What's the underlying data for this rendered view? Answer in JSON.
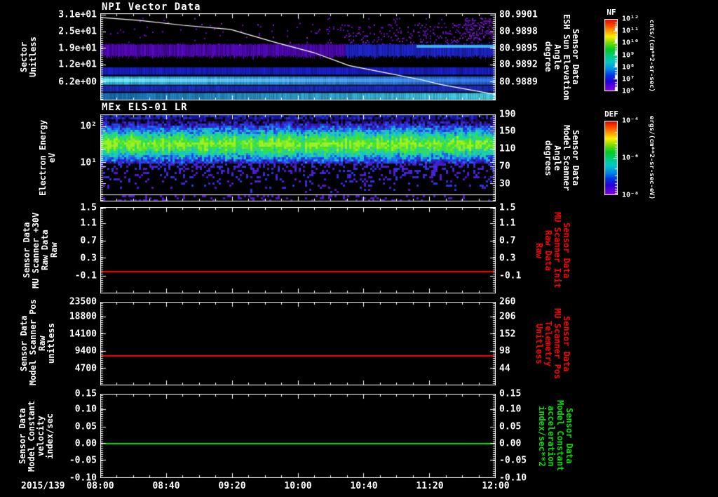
{
  "app": {
    "bg": "#000000",
    "fg": "#ffffff",
    "red": "#ff0000",
    "green": "#00e000"
  },
  "panels": {
    "p1": {
      "title": "NPI Vector Data",
      "left_title_lines": [
        "Sector",
        "Unitless"
      ],
      "left_ticks": [
        {
          "t": "3.1e+01",
          "f": 0.02
        },
        {
          "t": "2.5e+01",
          "f": 0.21
        },
        {
          "t": "1.9e+01",
          "f": 0.4
        },
        {
          "t": "1.2e+01",
          "f": 0.59
        },
        {
          "t": "6.2e+00",
          "f": 0.79
        }
      ],
      "right_ticks": [
        {
          "t": "80.9901",
          "f": 0.02
        },
        {
          "t": "80.9898",
          "f": 0.21
        },
        {
          "t": "80.9895",
          "f": 0.4
        },
        {
          "t": "80.9892",
          "f": 0.59
        },
        {
          "t": "80.9889",
          "f": 0.79
        }
      ],
      "right_title_lines": [
        "Sensor Data",
        "ESH Sun Elevation",
        "Angle",
        "degree"
      ]
    },
    "p2": {
      "title": "MEx ELS-01 LR",
      "left_title_lines": [
        "Electron Energy",
        "eV"
      ],
      "left_ticks": [
        {
          "t": "10²",
          "f": 0.137
        },
        {
          "t": "10¹",
          "f": 0.556
        }
      ],
      "right_ticks": [
        {
          "t": "190",
          "f": 0.0
        },
        {
          "t": "150",
          "f": 0.19
        },
        {
          "t": "110",
          "f": 0.395
        },
        {
          "t": "70",
          "f": 0.6
        },
        {
          "t": "30",
          "f": 0.8
        }
      ],
      "right_title_lines": [
        "Sensor Data",
        "Model Scanner",
        "Angle",
        "degrees"
      ]
    },
    "p3": {
      "left_title_lines": [
        "Sensor Data",
        "MU Scanner +30V",
        "Raw Data",
        "Raw"
      ],
      "left_ticks": [
        {
          "t": "1.5",
          "f": 0.01
        },
        {
          "t": "1.1",
          "f": 0.19
        },
        {
          "t": "0.7",
          "f": 0.39
        },
        {
          "t": "0.3",
          "f": 0.59
        },
        {
          "t": "-0.1",
          "f": 0.8
        }
      ],
      "right_ticks": [
        {
          "t": "1.5",
          "f": 0.01
        },
        {
          "t": "1.1",
          "f": 0.19
        },
        {
          "t": "0.7",
          "f": 0.39
        },
        {
          "t": "0.3",
          "f": 0.59
        },
        {
          "t": "-0.1",
          "f": 0.8
        }
      ],
      "right_title_lines": [
        "Sensor Data",
        "MU Scanner Init",
        "Raw Data",
        "Raw"
      ]
    },
    "p4": {
      "left_title_lines": [
        "Sensor Data",
        "Model Scanner Pos",
        "Raw",
        "unitless"
      ],
      "left_ticks": [
        {
          "t": "23500",
          "f": 0.0
        },
        {
          "t": "18800",
          "f": 0.18
        },
        {
          "t": "14100",
          "f": 0.385
        },
        {
          "t": "9400",
          "f": 0.59
        },
        {
          "t": "4700",
          "f": 0.8
        }
      ],
      "right_ticks": [
        {
          "t": "260",
          "f": 0.0
        },
        {
          "t": "206",
          "f": 0.18
        },
        {
          "t": "152",
          "f": 0.385
        },
        {
          "t": "98",
          "f": 0.59
        },
        {
          "t": "44",
          "f": 0.8
        }
      ],
      "right_title_lines": [
        "Sensor Data",
        "MU Scanner Pos",
        "Telemetry",
        "Unitless"
      ]
    },
    "p5": {
      "left_title_lines": [
        "Sensor Data",
        "Model Constant",
        "velocity",
        "index/sec"
      ],
      "left_ticks": [
        {
          "t": "0.15",
          "f": 0.0
        },
        {
          "t": "0.10",
          "f": 0.183
        },
        {
          "t": "0.05",
          "f": 0.392
        },
        {
          "t": "0.00",
          "f": 0.592
        },
        {
          "t": "-0.05",
          "f": 0.792
        },
        {
          "t": "-0.10",
          "f": 1.0
        }
      ],
      "right_ticks": [
        {
          "t": "0.15",
          "f": 0.0
        },
        {
          "t": "0.10",
          "f": 0.183
        },
        {
          "t": "0.05",
          "f": 0.392
        },
        {
          "t": "0.00",
          "f": 0.592
        },
        {
          "t": "-0.05",
          "f": 0.792
        },
        {
          "t": "-0.10",
          "f": 1.0
        }
      ],
      "right_title_lines": [
        "Sensor Data",
        "Model Constant",
        "acceleration",
        "index/sec**2"
      ]
    }
  },
  "xaxis": {
    "date": "2015/139",
    "ticks": [
      {
        "t": "08:00",
        "x": 0.0
      },
      {
        "t": "08:40",
        "x": 0.1667
      },
      {
        "t": "09:20",
        "x": 0.3333
      },
      {
        "t": "10:00",
        "x": 0.5
      },
      {
        "t": "10:40",
        "x": 0.6667
      },
      {
        "t": "11:20",
        "x": 0.8333
      },
      {
        "t": "12:00",
        "x": 1.0
      }
    ]
  },
  "colorbars": [
    {
      "name": "NF",
      "units": "cnts/(cm**2-sr-sec)",
      "ticks": [
        {
          "t": "10¹²",
          "f": 0.0
        },
        {
          "t": "10¹¹",
          "f": 0.1667
        },
        {
          "t": "10¹⁰",
          "f": 0.3333
        },
        {
          "t": "10⁹",
          "f": 0.5
        },
        {
          "t": "10⁸",
          "f": 0.6667
        },
        {
          "t": "10⁷",
          "f": 0.8333
        },
        {
          "t": "10⁶",
          "f": 1.0
        }
      ]
    },
    {
      "name": "DEF",
      "units": "ergs/(cm**2-sr-sec-eV)",
      "ticks": [
        {
          "t": "10⁻⁴",
          "f": 0.0
        },
        {
          "t": "10⁻⁶",
          "f": 0.5
        },
        {
          "t": "10⁻⁸",
          "f": 1.0
        }
      ]
    }
  ],
  "chart_data": {
    "type": "heatmap",
    "description": "Five stacked time-series panels, 2015/139 08:00 to 12:00 UT",
    "x_range": [
      "2015/139 08:00",
      "2015/139 12:00"
    ],
    "x_tick_labels": [
      "08:00",
      "08:40",
      "09:20",
      "10:00",
      "10:40",
      "11:20",
      "12:00"
    ],
    "colorbar_gradient": [
      [
        0.0,
        "#dd0000"
      ],
      [
        0.08,
        "#ff4400"
      ],
      [
        0.16,
        "#ff9900"
      ],
      [
        0.24,
        "#ffee00"
      ],
      [
        0.32,
        "#88dd00"
      ],
      [
        0.42,
        "#00cc22"
      ],
      [
        0.52,
        "#00cc88"
      ],
      [
        0.6,
        "#00c8c8"
      ],
      [
        0.7,
        "#0088e8"
      ],
      [
        0.78,
        "#0038e8"
      ],
      [
        0.87,
        "#2800d8"
      ],
      [
        1.0,
        "#8800e0"
      ]
    ],
    "panels": [
      {
        "id": "p1",
        "type": "spectrogram",
        "title": "NPI Vector Data",
        "ylabel": "Sector Unitless",
        "y_ticks": [
          31,
          25,
          19,
          12,
          6.2
        ],
        "right_axis_label": "Sensor Data ESH Sun Elevation Angle degree",
        "right_ticks": [
          80.9901,
          80.9898,
          80.9895,
          80.9892,
          80.9889
        ],
        "colorbar": "NF",
        "overlay_curve": {
          "meaning": "ESH Sun Elevation Angle decreasing from ~80.9901 to ~80.9889 deg",
          "points_frac": [
            [
              0,
              0.048
            ],
            [
              0.1,
              0.081
            ],
            [
              0.21,
              0.137
            ],
            [
              0.33,
              0.185
            ],
            [
              0.44,
              0.33
            ],
            [
              0.54,
              0.45
            ],
            [
              0.63,
              0.6
            ],
            [
              0.72,
              0.68
            ],
            [
              0.81,
              0.76
            ],
            [
              0.86,
              0.815
            ],
            [
              0.95,
              0.89
            ],
            [
              1.0,
              0.93
            ]
          ]
        },
        "bands_frac": [
          {
            "y0": 0.355,
            "y1": 0.48,
            "color_left": "#5a08c8",
            "color_right": "#2228e0"
          },
          {
            "y0": 0.62,
            "y1": 0.705,
            "color": "#1b22d8"
          },
          {
            "y0": 0.725,
            "y1": 0.82,
            "color": "#38d0f0"
          },
          {
            "y0": 0.83,
            "y1": 0.9,
            "color": "#2030cc"
          },
          {
            "y0": 0.915,
            "y1": 0.99,
            "color": "#1878c8"
          }
        ],
        "speckle_zone": {
          "y0": 0.05,
          "y1": 0.35,
          "color": "#7a10e0"
        }
      },
      {
        "id": "p2",
        "type": "spectrogram",
        "title": "MEx ELS-01 LR",
        "ylabel": "Electron Energy eV",
        "y_scale": "log",
        "y_ticks": [
          100,
          10
        ],
        "right_axis_label": "Sensor Data Model Scanner Angle degrees",
        "right_ticks": [
          190,
          150,
          110,
          70,
          30
        ],
        "colorbar": "DEF",
        "noise_band": {
          "center_f": 0.33,
          "half_f": 0.28
        },
        "hline_f": 0.92,
        "palette": [
          [
            0,
            "#000010"
          ],
          [
            0.18,
            "#3a14b8"
          ],
          [
            0.34,
            "#2248f0"
          ],
          [
            0.5,
            "#18b8e0"
          ],
          [
            0.66,
            "#20d890"
          ],
          [
            0.82,
            "#40e030"
          ],
          [
            1,
            "#a0f020"
          ]
        ]
      },
      {
        "id": "p3",
        "type": "line",
        "ylabel": "Sensor Data MU Scanner +30V Raw Data Raw",
        "ylim": [
          -0.5,
          1.5
        ],
        "value": 0.0,
        "f": 0.748,
        "color": "#ff0000",
        "series_note": "constant ~0.0 for whole interval"
      },
      {
        "id": "p4",
        "type": "line",
        "ylabel": "Sensor Data Model Scanner Pos Raw unitless",
        "ylim": [
          0,
          23500
        ],
        "value": 8100,
        "value_right_scale": 83,
        "f": 0.647,
        "color": "#ff0000",
        "series_note": "constant ~8100 for whole interval"
      },
      {
        "id": "p5",
        "type": "line",
        "ylabel": "Sensor Data Model Constant velocity index/sec",
        "ylim": [
          -0.1,
          0.15
        ],
        "value": 0.0,
        "f": 0.592,
        "color": "#00e000",
        "series_note": "constant 0.00 for whole interval"
      }
    ]
  }
}
